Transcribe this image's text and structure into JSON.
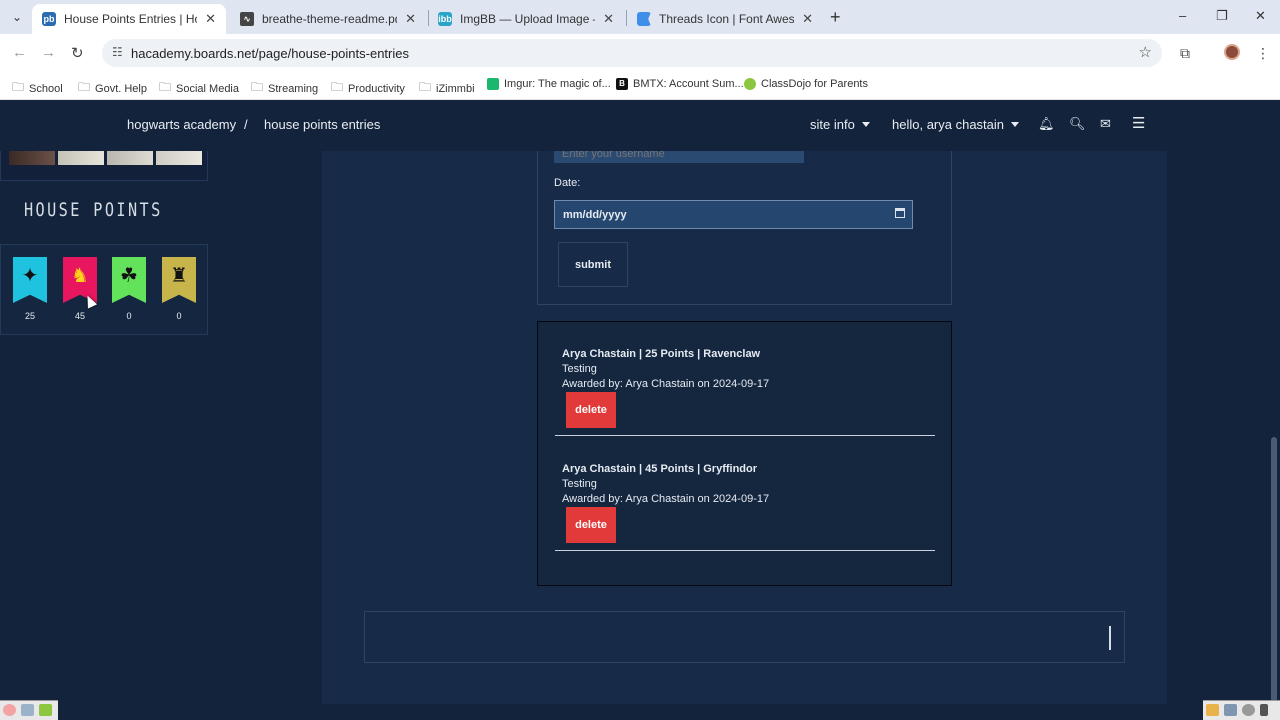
{
  "browser": {
    "tabs": [
      {
        "title": "House Points Entries | Hogwarts",
        "icon": "jcink-icon",
        "color": "#2b6cb0"
      },
      {
        "title": "breathe-theme-readme.pdf",
        "icon": "pdf-icon",
        "color": "#444"
      },
      {
        "title": "ImgBB — Upload Image — Free",
        "icon": "imgbb-icon",
        "color": "#2aa5c7"
      },
      {
        "title": "Threads Icon | Font Awesome",
        "icon": "flag-icon",
        "color": "#3f8ee8"
      }
    ],
    "address": "hacademy.boards.net/page/house-points-entries",
    "bookmarks": [
      {
        "label": "School",
        "type": "folder"
      },
      {
        "label": "Govt. Help",
        "type": "folder"
      },
      {
        "label": "Social Media",
        "type": "folder"
      },
      {
        "label": "Streaming",
        "type": "folder"
      },
      {
        "label": "Productivity",
        "type": "folder"
      },
      {
        "label": "iZimmbi",
        "type": "folder"
      },
      {
        "label": "Imgur: The magic of...",
        "type": "site",
        "color": "#1bb76e"
      },
      {
        "label": "BMTX: Account Sum...",
        "type": "site",
        "color": "#111"
      },
      {
        "label": "ClassDojo for Parents",
        "type": "site",
        "color": "#8dc63f"
      }
    ]
  },
  "header": {
    "breadcrumb_home": "hogwarts academy",
    "breadcrumb_sep": "/",
    "breadcrumb_current": "house points entries",
    "site_info": "site info",
    "greeting": "hello, arya chastain"
  },
  "sidebar": {
    "house_points_title": "HOUSE POINTS",
    "houses": [
      {
        "house": "Ravenclaw",
        "points": "25",
        "color": "#1fc3e0",
        "icon": "eagle-icon"
      },
      {
        "house": "Gryffindor",
        "points": "45",
        "color": "#e8155f",
        "icon": "lion-icon"
      },
      {
        "house": "Slytherin",
        "points": "0",
        "color": "#63e35b",
        "icon": "snake-icon"
      },
      {
        "house": "Hufflepuff",
        "points": "0",
        "color": "#c7b54c",
        "icon": "badger-icon"
      }
    ]
  },
  "form": {
    "username_placeholder": "Enter your username",
    "date_label": "Date:",
    "date_placeholder": "mm/dd/yyyy",
    "submit_label": "submit"
  },
  "entries": [
    {
      "title": "Arya Chastain | 25 Points | Ravenclaw",
      "reason": "Testing",
      "awarded": "Awarded by: Arya Chastain on 2024-09-17",
      "delete_label": "delete"
    },
    {
      "title": "Arya Chastain | 45 Points | Gryffindor",
      "reason": "Testing",
      "awarded": "Awarded by: Arya Chastain on 2024-09-17",
      "delete_label": "delete"
    }
  ],
  "colors": {
    "background": "#13233b",
    "panel": "#172a47",
    "delete": "#e23a3a"
  }
}
